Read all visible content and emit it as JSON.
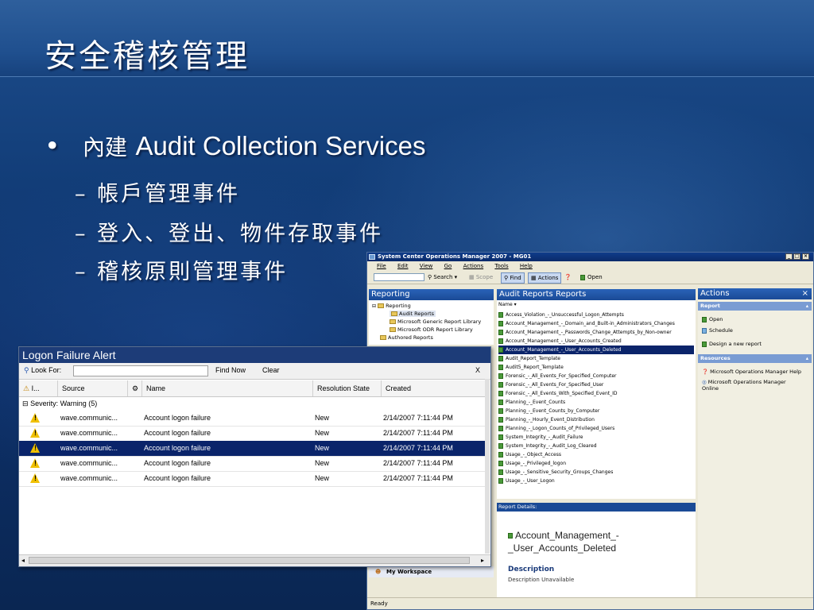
{
  "slide": {
    "title": "安全稽核管理",
    "bullet_prefix": "內建",
    "bullet_main": "Audit Collection Services",
    "subbullets": [
      "帳戶管理事件",
      "登入、登出、物件存取事件",
      "稽核原則管理事件"
    ],
    "dash": "–",
    "bullet_mark": "•"
  },
  "scom": {
    "window_title": "System Center Operations Manager 2007 - MG01",
    "controls": [
      "_",
      "□",
      "×"
    ],
    "menu": [
      "File",
      "Edit",
      "View",
      "Go",
      "Actions",
      "Tools",
      "Help"
    ],
    "toolbar": {
      "search": "Search",
      "scope": "Scope",
      "find": "Find",
      "actions": "Actions",
      "open": "Open"
    },
    "reporting_header": "Reporting",
    "tree": [
      "Reporting",
      "Audit Reports",
      "Microsoft Generic Report Library",
      "Microsoft ODR Report Library",
      "Authored Reports"
    ],
    "reports_header": "Audit Reports Reports",
    "name_col": "Name",
    "reports": [
      "Access_Violation_-_Unsuccessful_Logon_Attempts",
      "Account_Management_-_Domain_and_Built-in_Administrators_Changes",
      "Account_Management_-_Passwords_Change_Attempts_by_Non-owner",
      "Account_Management_-_User_Accounts_Created",
      "Account_Management_-_User_Accounts_Deleted",
      "Audit_Report_Template",
      "Audit5_Report_Template",
      "Forensic_-_All_Events_For_Specified_Computer",
      "Forensic_-_All_Events_For_Specified_User",
      "Forensic_-_All_Events_With_Specified_Event_ID",
      "Planning_-_Event_Counts",
      "Planning_-_Event_Counts_by_Computer",
      "Planning_-_Hourly_Event_Distribution",
      "Planning_-_Logon_Counts_of_Privileged_Users",
      "System_Integrity_-_Audit_Failure",
      "System_Integrity_-_Audit_Log_Cleared",
      "Usage_-_Object_Access",
      "Usage_-_Privileged_logon",
      "Usage_-_Sensitive_Security_Groups_Changes",
      "Usage_-_User_Logon"
    ],
    "selected_report_index": 4,
    "report_details_label": "Report Details:",
    "details_title": "Account_Management_-_User_Accounts_Deleted",
    "description_label": "Description",
    "description_value": "Description Unavailable",
    "actions_header": "Actions",
    "report_section": "Report",
    "report_actions": [
      "Open",
      "Schedule",
      "Design a new report"
    ],
    "resources_section": "Resources",
    "resources": [
      "Microsoft Operations Manager Help",
      "Microsoft Operations Manager Online"
    ],
    "my_workspace": "My Workspace",
    "status": "Ready"
  },
  "alert": {
    "title": "Logon Failure Alert",
    "look_for": "Look For:",
    "find_now": "Find Now",
    "clear": "Clear",
    "close": "X",
    "columns": [
      "I...",
      "Source",
      "Name",
      "Resolution State",
      "Created"
    ],
    "group": "Severity: Warning (5)",
    "rows": [
      {
        "source": "wave.communic...",
        "name": "Account logon failure",
        "state": "New",
        "created": "2/14/2007 7:11:44 PM"
      },
      {
        "source": "wave.communic...",
        "name": "Account logon failure",
        "state": "New",
        "created": "2/14/2007 7:11:44 PM"
      },
      {
        "source": "wave.communic...",
        "name": "Account logon failure",
        "state": "New",
        "created": "2/14/2007 7:11:44 PM"
      },
      {
        "source": "wave.communic...",
        "name": "Account logon failure",
        "state": "New",
        "created": "2/14/2007 7:11:44 PM"
      },
      {
        "source": "wave.communic...",
        "name": "Account logon failure",
        "state": "New",
        "created": "2/14/2007 7:11:44 PM"
      }
    ],
    "selected_row_index": 2
  }
}
